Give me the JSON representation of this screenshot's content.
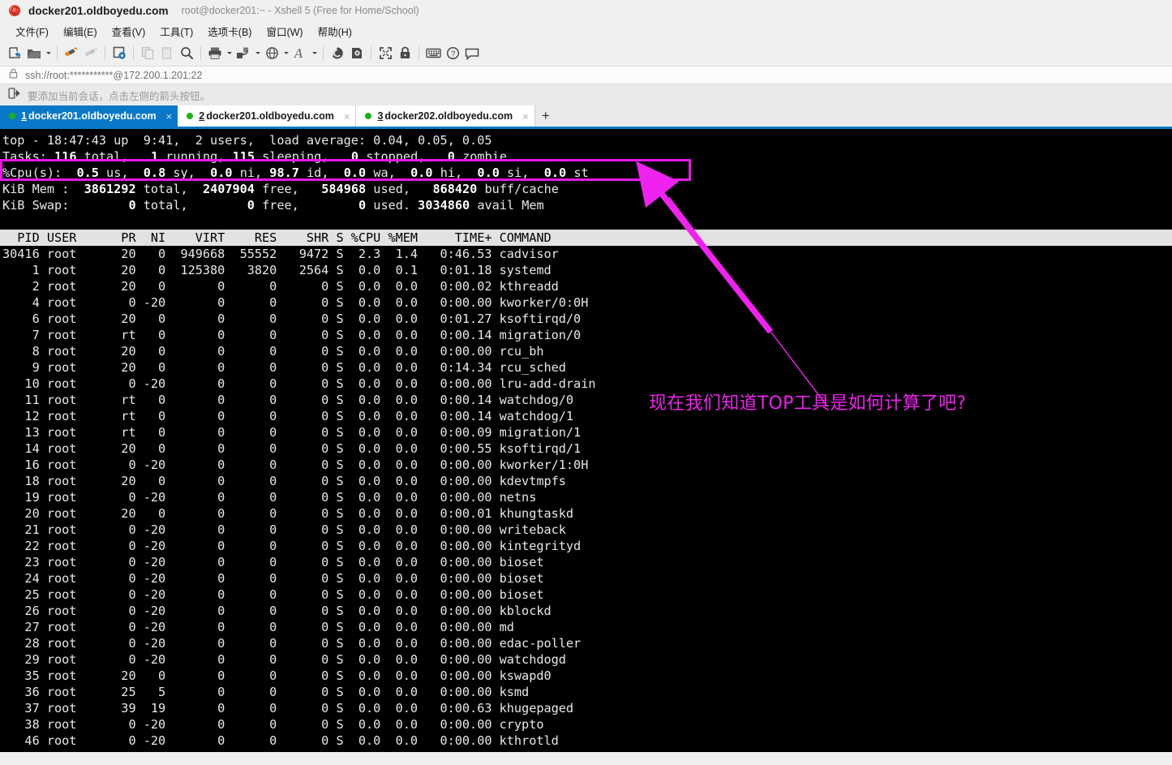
{
  "window": {
    "app_icon": "xshell-logo-icon",
    "title": "docker201.oldboyedu.com",
    "subtitle": "root@docker201:~ - Xshell 5 (Free for Home/School)"
  },
  "menubar": {
    "items": [
      {
        "label": "文件(F)",
        "name": "menu-file"
      },
      {
        "label": "编辑(E)",
        "name": "menu-edit"
      },
      {
        "label": "查看(V)",
        "name": "menu-view"
      },
      {
        "label": "工具(T)",
        "name": "menu-tools"
      },
      {
        "label": "选项卡(B)",
        "name": "menu-tabs"
      },
      {
        "label": "窗口(W)",
        "name": "menu-window"
      },
      {
        "label": "帮助(H)",
        "name": "menu-help"
      }
    ]
  },
  "toolbar": {
    "buttons": [
      "new-session-icon",
      "open-folder-icon",
      "open-folder-caret",
      "separator",
      "connect-icon",
      "disconnect-icon",
      "separator",
      "session-properties-icon",
      "separator",
      "copy-icon",
      "paste-icon",
      "find-icon",
      "separator",
      "print-icon",
      "print-caret",
      "transfer-file-icon",
      "transfer-caret",
      "globe-icon",
      "globe-caret",
      "font-icon",
      "font-caret",
      "separator",
      "log-session-icon",
      "script-icon",
      "separator",
      "fullscreen-icon",
      "lock-icon",
      "separator",
      "keyboard-icon",
      "help-icon",
      "feedback-icon"
    ]
  },
  "addressbar": {
    "lock_icon": "lock-icon",
    "url": "ssh://root:***********@172.200.1.201:22"
  },
  "hintbar": {
    "icon": "add-session-arrow-icon",
    "text": "要添加当前会话，点击左侧的箭头按钮。"
  },
  "tabs": {
    "items": [
      {
        "num": "1",
        "label": "docker201.oldboyedu.com",
        "active": true,
        "close": "×",
        "status": "connected"
      },
      {
        "num": "2",
        "label": "docker201.oldboyedu.com",
        "active": false,
        "close": "×",
        "status": "connected"
      },
      {
        "num": "3",
        "label": "docker202.oldboyedu.com",
        "active": false,
        "close": "×",
        "status": "connected"
      }
    ],
    "add_label": "+"
  },
  "terminal": {
    "summary": {
      "line1_plain": "top - 18:47:43 up  9:41,  2 users,  load average: 0.04, 0.05, 0.05",
      "tasks": {
        "label": "Tasks:",
        "total": "116",
        "total_label": "total,",
        "running": "1",
        "running_label": "running,",
        "sleeping": "115",
        "sleeping_label": "sleeping,",
        "stopped": "0",
        "stopped_label": "stopped,",
        "zombie": "0",
        "zombie_label": "zombie"
      },
      "cpu": {
        "label": "%Cpu(s):",
        "us": "0.5",
        "us_label": "us,",
        "sy": "0.8",
        "sy_label": "sy,",
        "ni": "0.0",
        "ni_label": "ni,",
        "id": "98.7",
        "id_label": "id,",
        "wa": "0.0",
        "wa_label": "wa,",
        "hi": "0.0",
        "hi_label": "hi,",
        "si": "0.0",
        "si_label": "si,",
        "st": "0.0",
        "st_label": "st"
      },
      "mem": {
        "label": "KiB Mem :",
        "total": "3861292",
        "total_label": "total,",
        "free": "2407904",
        "free_label": "free,",
        "used": "584968",
        "used_label": "used,",
        "buffcache": "868420",
        "buffcache_label": "buff/cache"
      },
      "swap": {
        "label": "KiB Swap:",
        "total": "0",
        "total_label": "total,",
        "free": "0",
        "free_label": "free,",
        "used": "0",
        "used_label": "used.",
        "avail": "3034860",
        "avail_label": "avail Mem"
      }
    },
    "columns": [
      "PID",
      "USER",
      "PR",
      "NI",
      "VIRT",
      "RES",
      "SHR",
      "S",
      "%CPU",
      "%MEM",
      "TIME+",
      "COMMAND"
    ],
    "header_line": "  PID USER      PR  NI    VIRT    RES    SHR S %CPU %MEM     TIME+ COMMAND",
    "rows": [
      {
        "pid": "30416",
        "user": "root",
        "pr": "20",
        "ni": "0",
        "virt": "949668",
        "res": "55552",
        "shr": "9472",
        "s": "S",
        "cpu": "2.3",
        "mem": "1.4",
        "time": "0:46.53",
        "command": "cadvisor"
      },
      {
        "pid": "1",
        "user": "root",
        "pr": "20",
        "ni": "0",
        "virt": "125380",
        "res": "3820",
        "shr": "2564",
        "s": "S",
        "cpu": "0.0",
        "mem": "0.1",
        "time": "0:01.18",
        "command": "systemd"
      },
      {
        "pid": "2",
        "user": "root",
        "pr": "20",
        "ni": "0",
        "virt": "0",
        "res": "0",
        "shr": "0",
        "s": "S",
        "cpu": "0.0",
        "mem": "0.0",
        "time": "0:00.02",
        "command": "kthreadd"
      },
      {
        "pid": "4",
        "user": "root",
        "pr": "0",
        "ni": "-20",
        "virt": "0",
        "res": "0",
        "shr": "0",
        "s": "S",
        "cpu": "0.0",
        "mem": "0.0",
        "time": "0:00.00",
        "command": "kworker/0:0H"
      },
      {
        "pid": "6",
        "user": "root",
        "pr": "20",
        "ni": "0",
        "virt": "0",
        "res": "0",
        "shr": "0",
        "s": "S",
        "cpu": "0.0",
        "mem": "0.0",
        "time": "0:01.27",
        "command": "ksoftirqd/0"
      },
      {
        "pid": "7",
        "user": "root",
        "pr": "rt",
        "ni": "0",
        "virt": "0",
        "res": "0",
        "shr": "0",
        "s": "S",
        "cpu": "0.0",
        "mem": "0.0",
        "time": "0:00.14",
        "command": "migration/0"
      },
      {
        "pid": "8",
        "user": "root",
        "pr": "20",
        "ni": "0",
        "virt": "0",
        "res": "0",
        "shr": "0",
        "s": "S",
        "cpu": "0.0",
        "mem": "0.0",
        "time": "0:00.00",
        "command": "rcu_bh"
      },
      {
        "pid": "9",
        "user": "root",
        "pr": "20",
        "ni": "0",
        "virt": "0",
        "res": "0",
        "shr": "0",
        "s": "S",
        "cpu": "0.0",
        "mem": "0.0",
        "time": "0:14.34",
        "command": "rcu_sched"
      },
      {
        "pid": "10",
        "user": "root",
        "pr": "0",
        "ni": "-20",
        "virt": "0",
        "res": "0",
        "shr": "0",
        "s": "S",
        "cpu": "0.0",
        "mem": "0.0",
        "time": "0:00.00",
        "command": "lru-add-drain"
      },
      {
        "pid": "11",
        "user": "root",
        "pr": "rt",
        "ni": "0",
        "virt": "0",
        "res": "0",
        "shr": "0",
        "s": "S",
        "cpu": "0.0",
        "mem": "0.0",
        "time": "0:00.14",
        "command": "watchdog/0"
      },
      {
        "pid": "12",
        "user": "root",
        "pr": "rt",
        "ni": "0",
        "virt": "0",
        "res": "0",
        "shr": "0",
        "s": "S",
        "cpu": "0.0",
        "mem": "0.0",
        "time": "0:00.14",
        "command": "watchdog/1"
      },
      {
        "pid": "13",
        "user": "root",
        "pr": "rt",
        "ni": "0",
        "virt": "0",
        "res": "0",
        "shr": "0",
        "s": "S",
        "cpu": "0.0",
        "mem": "0.0",
        "time": "0:00.09",
        "command": "migration/1"
      },
      {
        "pid": "14",
        "user": "root",
        "pr": "20",
        "ni": "0",
        "virt": "0",
        "res": "0",
        "shr": "0",
        "s": "S",
        "cpu": "0.0",
        "mem": "0.0",
        "time": "0:00.55",
        "command": "ksoftirqd/1"
      },
      {
        "pid": "16",
        "user": "root",
        "pr": "0",
        "ni": "-20",
        "virt": "0",
        "res": "0",
        "shr": "0",
        "s": "S",
        "cpu": "0.0",
        "mem": "0.0",
        "time": "0:00.00",
        "command": "kworker/1:0H"
      },
      {
        "pid": "18",
        "user": "root",
        "pr": "20",
        "ni": "0",
        "virt": "0",
        "res": "0",
        "shr": "0",
        "s": "S",
        "cpu": "0.0",
        "mem": "0.0",
        "time": "0:00.00",
        "command": "kdevtmpfs"
      },
      {
        "pid": "19",
        "user": "root",
        "pr": "0",
        "ni": "-20",
        "virt": "0",
        "res": "0",
        "shr": "0",
        "s": "S",
        "cpu": "0.0",
        "mem": "0.0",
        "time": "0:00.00",
        "command": "netns"
      },
      {
        "pid": "20",
        "user": "root",
        "pr": "20",
        "ni": "0",
        "virt": "0",
        "res": "0",
        "shr": "0",
        "s": "S",
        "cpu": "0.0",
        "mem": "0.0",
        "time": "0:00.01",
        "command": "khungtaskd"
      },
      {
        "pid": "21",
        "user": "root",
        "pr": "0",
        "ni": "-20",
        "virt": "0",
        "res": "0",
        "shr": "0",
        "s": "S",
        "cpu": "0.0",
        "mem": "0.0",
        "time": "0:00.00",
        "command": "writeback"
      },
      {
        "pid": "22",
        "user": "root",
        "pr": "0",
        "ni": "-20",
        "virt": "0",
        "res": "0",
        "shr": "0",
        "s": "S",
        "cpu": "0.0",
        "mem": "0.0",
        "time": "0:00.00",
        "command": "kintegrityd"
      },
      {
        "pid": "23",
        "user": "root",
        "pr": "0",
        "ni": "-20",
        "virt": "0",
        "res": "0",
        "shr": "0",
        "s": "S",
        "cpu": "0.0",
        "mem": "0.0",
        "time": "0:00.00",
        "command": "bioset"
      },
      {
        "pid": "24",
        "user": "root",
        "pr": "0",
        "ni": "-20",
        "virt": "0",
        "res": "0",
        "shr": "0",
        "s": "S",
        "cpu": "0.0",
        "mem": "0.0",
        "time": "0:00.00",
        "command": "bioset"
      },
      {
        "pid": "25",
        "user": "root",
        "pr": "0",
        "ni": "-20",
        "virt": "0",
        "res": "0",
        "shr": "0",
        "s": "S",
        "cpu": "0.0",
        "mem": "0.0",
        "time": "0:00.00",
        "command": "bioset"
      },
      {
        "pid": "26",
        "user": "root",
        "pr": "0",
        "ni": "-20",
        "virt": "0",
        "res": "0",
        "shr": "0",
        "s": "S",
        "cpu": "0.0",
        "mem": "0.0",
        "time": "0:00.00",
        "command": "kblockd"
      },
      {
        "pid": "27",
        "user": "root",
        "pr": "0",
        "ni": "-20",
        "virt": "0",
        "res": "0",
        "shr": "0",
        "s": "S",
        "cpu": "0.0",
        "mem": "0.0",
        "time": "0:00.00",
        "command": "md"
      },
      {
        "pid": "28",
        "user": "root",
        "pr": "0",
        "ni": "-20",
        "virt": "0",
        "res": "0",
        "shr": "0",
        "s": "S",
        "cpu": "0.0",
        "mem": "0.0",
        "time": "0:00.00",
        "command": "edac-poller"
      },
      {
        "pid": "29",
        "user": "root",
        "pr": "0",
        "ni": "-20",
        "virt": "0",
        "res": "0",
        "shr": "0",
        "s": "S",
        "cpu": "0.0",
        "mem": "0.0",
        "time": "0:00.00",
        "command": "watchdogd"
      },
      {
        "pid": "35",
        "user": "root",
        "pr": "20",
        "ni": "0",
        "virt": "0",
        "res": "0",
        "shr": "0",
        "s": "S",
        "cpu": "0.0",
        "mem": "0.0",
        "time": "0:00.00",
        "command": "kswapd0"
      },
      {
        "pid": "36",
        "user": "root",
        "pr": "25",
        "ni": "5",
        "virt": "0",
        "res": "0",
        "shr": "0",
        "s": "S",
        "cpu": "0.0",
        "mem": "0.0",
        "time": "0:00.00",
        "command": "ksmd"
      },
      {
        "pid": "37",
        "user": "root",
        "pr": "39",
        "ni": "19",
        "virt": "0",
        "res": "0",
        "shr": "0",
        "s": "S",
        "cpu": "0.0",
        "mem": "0.0",
        "time": "0:00.63",
        "command": "khugepaged"
      },
      {
        "pid": "38",
        "user": "root",
        "pr": "0",
        "ni": "-20",
        "virt": "0",
        "res": "0",
        "shr": "0",
        "s": "S",
        "cpu": "0.0",
        "mem": "0.0",
        "time": "0:00.00",
        "command": "crypto"
      },
      {
        "pid": "46",
        "user": "root",
        "pr": "0",
        "ni": "-20",
        "virt": "0",
        "res": "0",
        "shr": "0",
        "s": "S",
        "cpu": "0.0",
        "mem": "0.0",
        "time": "0:00.00",
        "command": "kthrotld"
      }
    ]
  },
  "annotation": {
    "text": "现在我们知道TOP工具是如何计算了吧?",
    "color": "#ef22ef",
    "highlight_target": "cpu-line"
  }
}
